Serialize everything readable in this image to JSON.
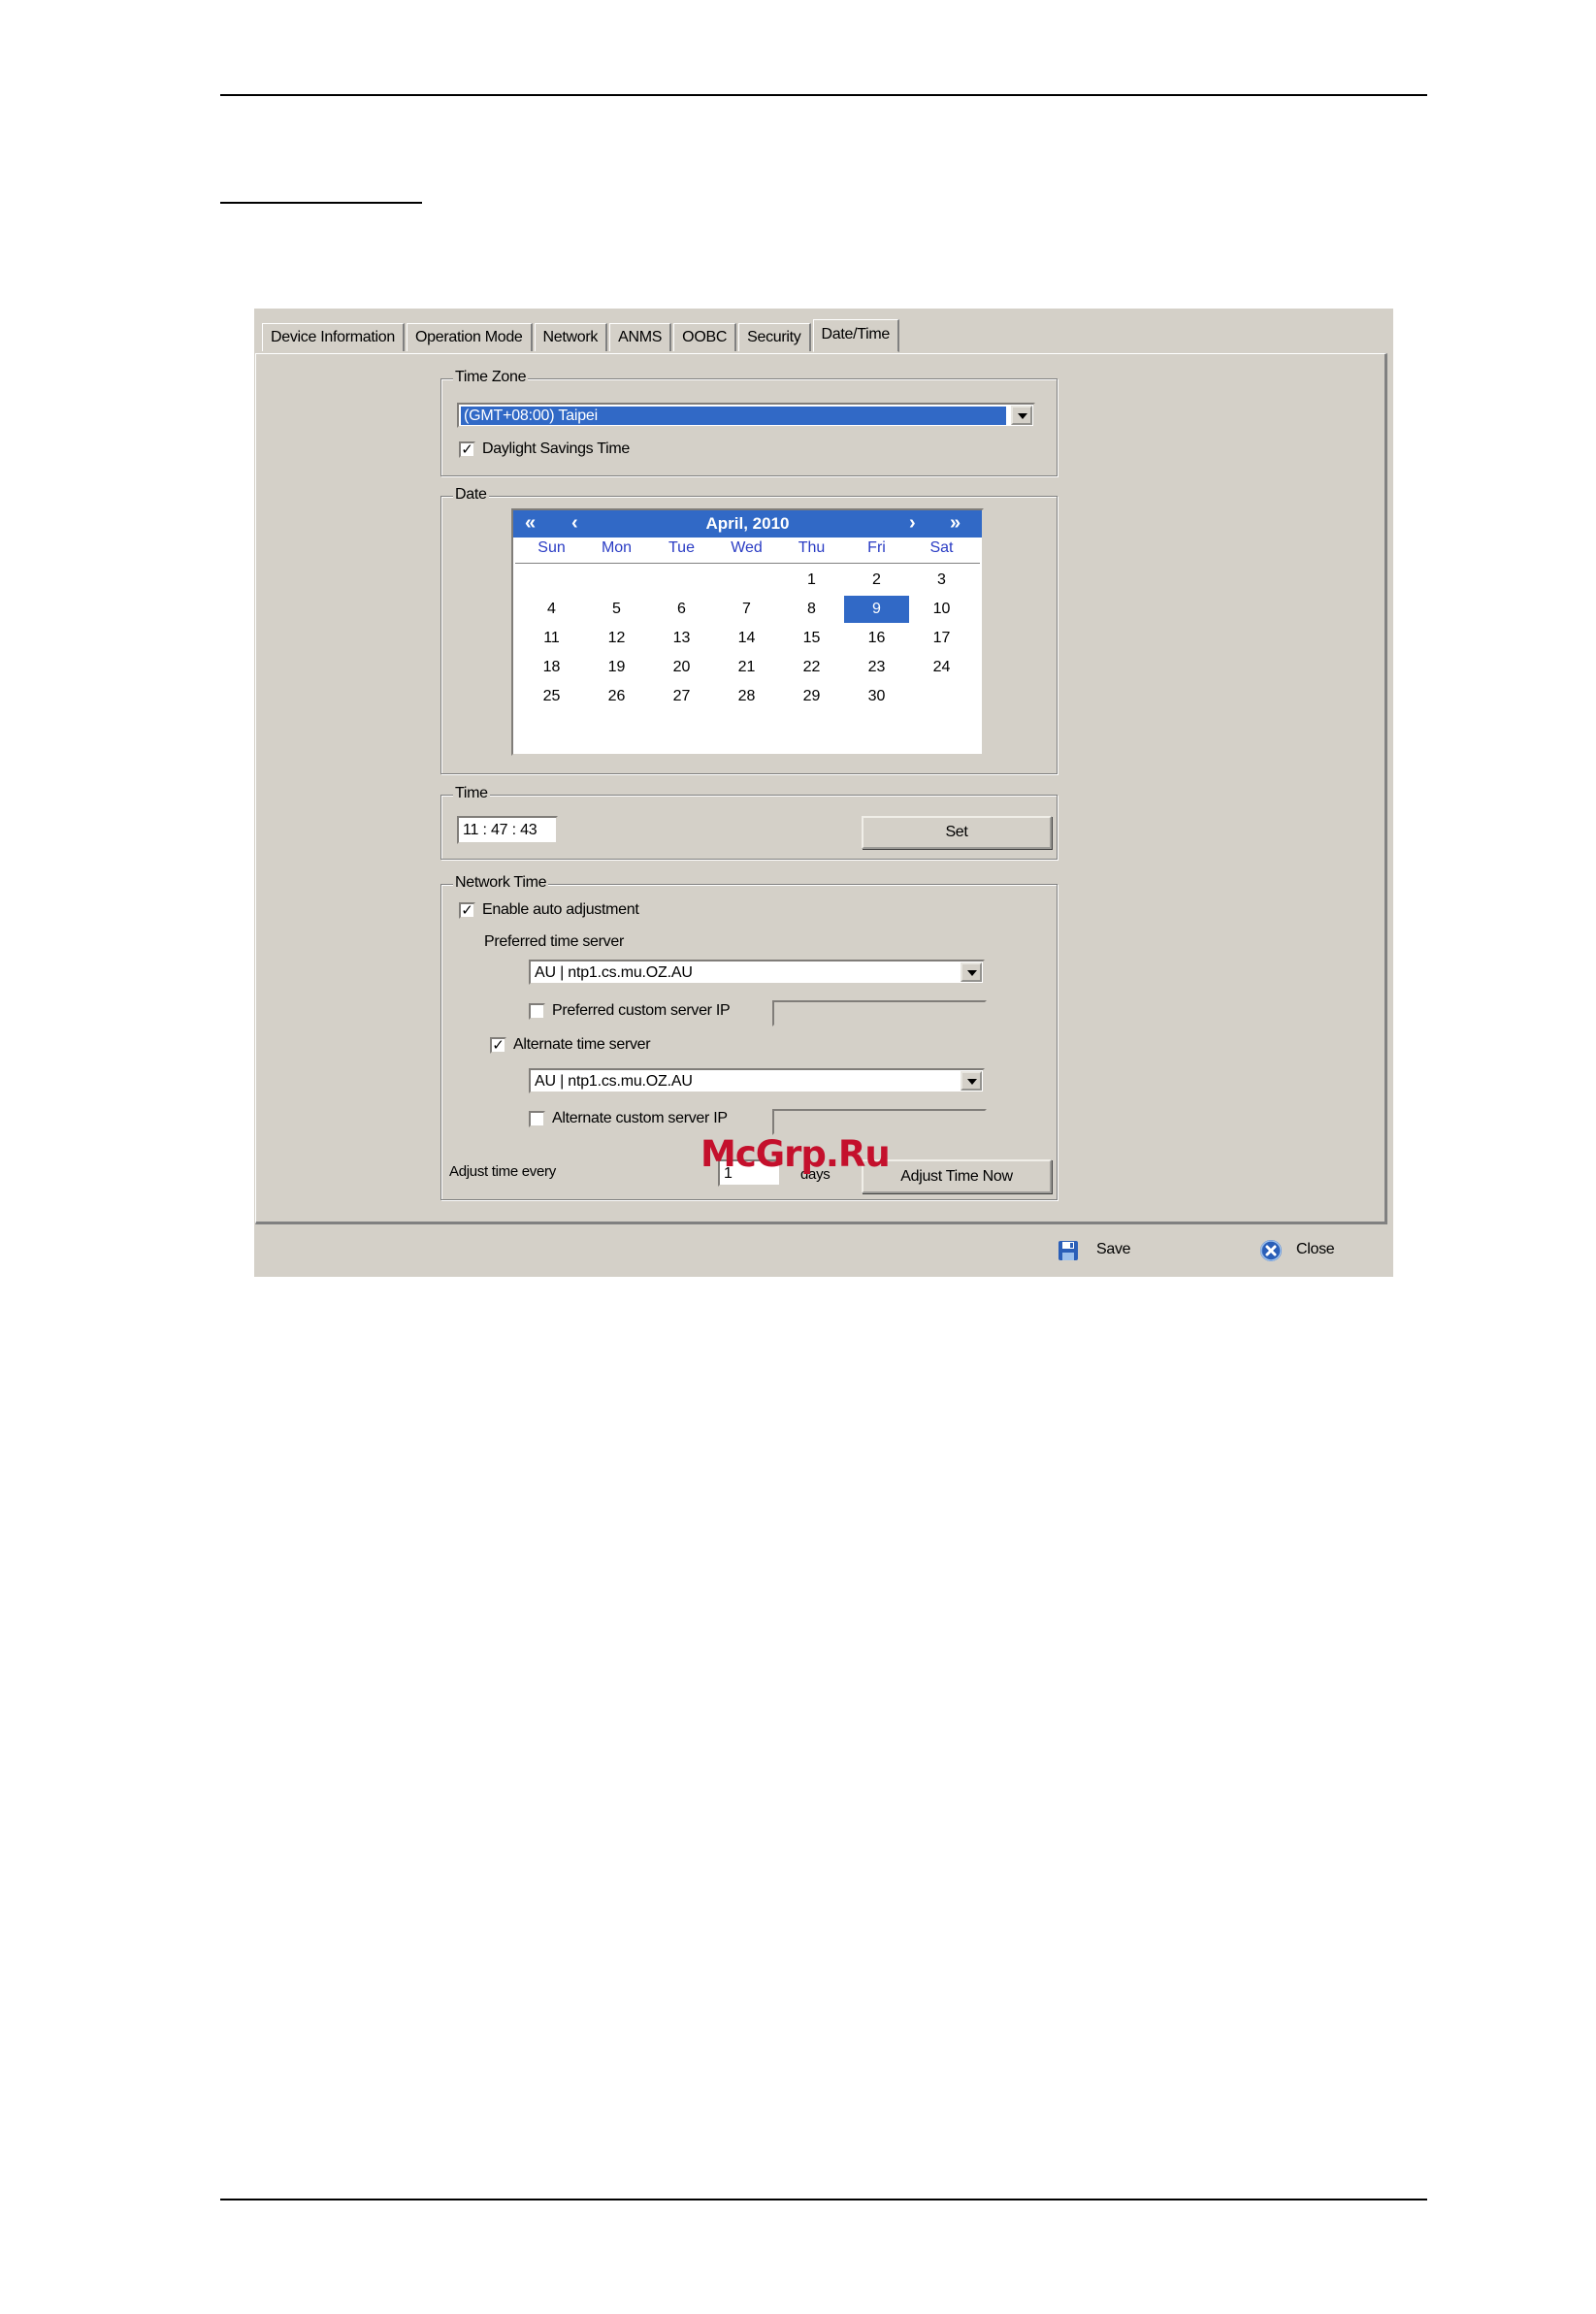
{
  "tabs": [
    "Device Information",
    "Operation Mode",
    "Network",
    "ANMS",
    "OOBC",
    "Security",
    "Date/Time"
  ],
  "active_tab": "Date/Time",
  "time_zone": {
    "label": "Time Zone",
    "selected": "(GMT+08:00) Taipei",
    "daylight_label": "Daylight Savings Time",
    "daylight_checked": true
  },
  "date": {
    "label": "Date",
    "month_title": "April, 2010",
    "nav": {
      "prev_year": "«",
      "prev_month": "‹",
      "next_month": "›",
      "next_year": "»"
    },
    "weekdays": [
      "Sun",
      "Mon",
      "Tue",
      "Wed",
      "Thu",
      "Fri",
      "Sat"
    ],
    "weeks": [
      [
        "",
        "",
        "",
        "",
        "1",
        "2",
        "3"
      ],
      [
        "4",
        "5",
        "6",
        "7",
        "8",
        "9",
        "10"
      ],
      [
        "11",
        "12",
        "13",
        "14",
        "15",
        "16",
        "17"
      ],
      [
        "18",
        "19",
        "20",
        "21",
        "22",
        "23",
        "24"
      ],
      [
        "25",
        "26",
        "27",
        "28",
        "29",
        "30",
        ""
      ]
    ],
    "selected_day": "9"
  },
  "time": {
    "label": "Time",
    "value": "11 : 47 : 43",
    "set_button": "Set"
  },
  "network_time": {
    "label": "Network Time",
    "enable_label": "Enable auto adjustment",
    "enable_checked": true,
    "preferred_label": "Preferred time server",
    "preferred_server": "AU | ntp1.cs.mu.OZ.AU",
    "preferred_custom_label": "Preferred custom server IP",
    "preferred_custom_checked": false,
    "alternate_label": "Alternate time server",
    "alternate_checked": true,
    "alternate_server": "AU | ntp1.cs.mu.OZ.AU",
    "alternate_custom_label": "Alternate custom server IP",
    "alternate_custom_checked": false,
    "adjust_label": "Adjust time every",
    "adjust_value": "1",
    "days_label": "days",
    "adjust_now_button": "Adjust Time Now"
  },
  "footer": {
    "save": "Save",
    "close": "Close"
  },
  "watermark": "McGrp.Ru",
  "colors": {
    "selection": "#3169c6",
    "dialog_bg": "#d4d0c8",
    "watermark": "#c4102c"
  }
}
